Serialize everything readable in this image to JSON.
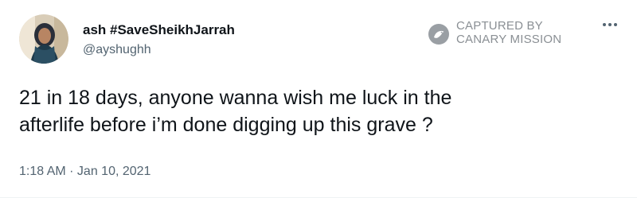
{
  "tweet": {
    "display_name": "ash #SaveSheikhJarrah",
    "handle": "@ayshughh",
    "text_line1": "21 in 18 days, anyone wanna wish me luck in the",
    "text_line2": "afterlife before i’m done digging up this grave ?",
    "timestamp": "1:18 AM · Jan 10, 2021",
    "more_icon": "more-horizontal-icon"
  },
  "watermark": {
    "line1": "CAPTURED BY",
    "line2": "CANARY MISSION",
    "icon": "canary-bird-icon"
  },
  "colors": {
    "text_primary": "#0f1419",
    "text_secondary": "#536471",
    "watermark_gray": "#8a8f94"
  }
}
